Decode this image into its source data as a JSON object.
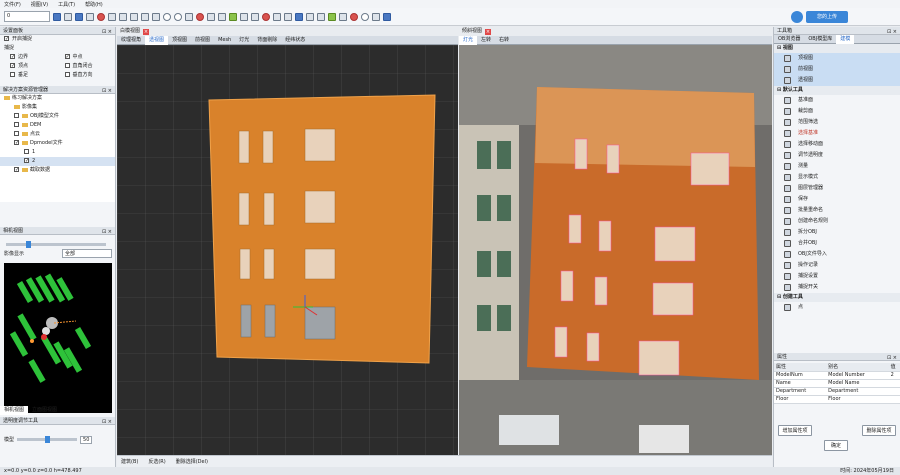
{
  "menu": {
    "items": [
      "文件(F)",
      "视图(V)",
      "工具(T)",
      "帮助(H)"
    ]
  },
  "toolbar": {
    "combo_value": "0",
    "login_label": "您的上传"
  },
  "left_panel": {
    "settings_title": "设置面板",
    "enable_snap_label": "开启捕捉",
    "snap_label": "捕捉",
    "snap_options": [
      {
        "label": "边界",
        "checked": true
      },
      {
        "label": "中点",
        "checked": true
      },
      {
        "label": "顶点",
        "checked": true
      },
      {
        "label": "直角闭合",
        "checked": false
      },
      {
        "label": "垂足",
        "checked": false
      },
      {
        "label": "垂直方向",
        "checked": false
      }
    ],
    "solution_title": "解决方案资源管理器",
    "tree": [
      {
        "label": "练习解决方案",
        "indent": 0
      },
      {
        "label": "影像集",
        "indent": 1
      },
      {
        "label": "OBJ模型文件",
        "indent": 1
      },
      {
        "label": "DEM",
        "indent": 1
      },
      {
        "label": "点云",
        "indent": 1
      },
      {
        "label": "Dpmodel文件",
        "indent": 1
      },
      {
        "label": "1",
        "indent": 2
      },
      {
        "label": "2",
        "indent": 2
      },
      {
        "label": "截取数据",
        "indent": 1
      }
    ],
    "camera_title": "相机视图",
    "image_display_label": "影像显示",
    "image_display_value": "全部",
    "bottom_tabs": [
      "相机视图",
      "立面图视图"
    ],
    "transparency_title": "透明度调节工具",
    "transparency_label": "模型",
    "transparency_value": "50",
    "transparency_pct": 0.5
  },
  "left_view": {
    "doc_tab": "白模视图",
    "tabs": [
      "纹理视角",
      "透视图",
      "顶视图",
      "前视图",
      "Mesh",
      "灯光",
      "背面剔除",
      "经纬状态"
    ],
    "active_tab": 1
  },
  "right_view": {
    "doc_tab": "倾斜视图",
    "tabs": [
      "灯光",
      "左转",
      "右转"
    ],
    "active_tab": 0
  },
  "right_panel": {
    "title": "工具箱",
    "tabs": [
      "OB浏览器",
      "OBJ模型库",
      "建模"
    ],
    "active_tab": 2,
    "groups": [
      {
        "name": "视图",
        "items": [
          "顶视图",
          "前视图",
          "透视图"
        ]
      },
      {
        "name": "默认工具",
        "items": [
          "基准面",
          "裁剪面",
          "范围筛选",
          "选择基准",
          "选择移动面",
          "调节透明度",
          "测量",
          "显示模式",
          "图层管理器",
          "保存",
          "批量重命名",
          "创建命名规则",
          "拆分OBJ",
          "合并OBJ",
          "OBJ文件导入",
          "操作记录",
          "捕捉设置",
          "捕捉开关"
        ]
      },
      {
        "name": "创建工具",
        "items": [
          "点"
        ]
      }
    ],
    "hot_item": "选择基准",
    "attr_title": "属性",
    "attr_headers": [
      "属性",
      "别名",
      "值"
    ],
    "attr_rows": [
      [
        "ModelNum",
        "Model Number",
        "2"
      ],
      [
        "Name",
        "Model Name",
        ""
      ],
      [
        "Department",
        "Department",
        ""
      ],
      [
        "Floor",
        "Floor",
        ""
      ]
    ],
    "add_attr_label": "增加属性项",
    "del_attr_label": "删除属性项",
    "ok_label": "确定"
  },
  "bottom_bar": {
    "items": [
      "建筑(B)",
      "反选(R)",
      "删除选择(Del)"
    ]
  },
  "statusbar": {
    "left": "x=0.0 y=0.0 z=0.0 h=478.497",
    "right": "时间: 2024年05月19日"
  },
  "colors": {
    "accent": "#3a86d8",
    "building": "#d9822b",
    "grid": "#4a4a4a",
    "window": "#e8d2bb"
  }
}
